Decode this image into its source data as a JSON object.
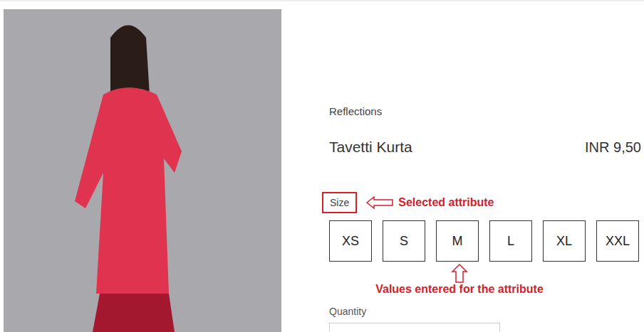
{
  "product": {
    "brand": "Reflections",
    "title": "Tavetti Kurta",
    "price": "INR 9,50"
  },
  "attribute": {
    "label": "Size",
    "annotation": "Selected attribute"
  },
  "sizes": [
    {
      "label": "XS",
      "selected": false
    },
    {
      "label": "S",
      "selected": false
    },
    {
      "label": "M",
      "selected": false
    },
    {
      "label": "L",
      "selected": false
    },
    {
      "label": "XL",
      "selected": false
    },
    {
      "label": "XXL",
      "selected": false
    }
  ],
  "values_annotation": "Values entered for the attribute",
  "quantity": {
    "label": "Quantity"
  }
}
